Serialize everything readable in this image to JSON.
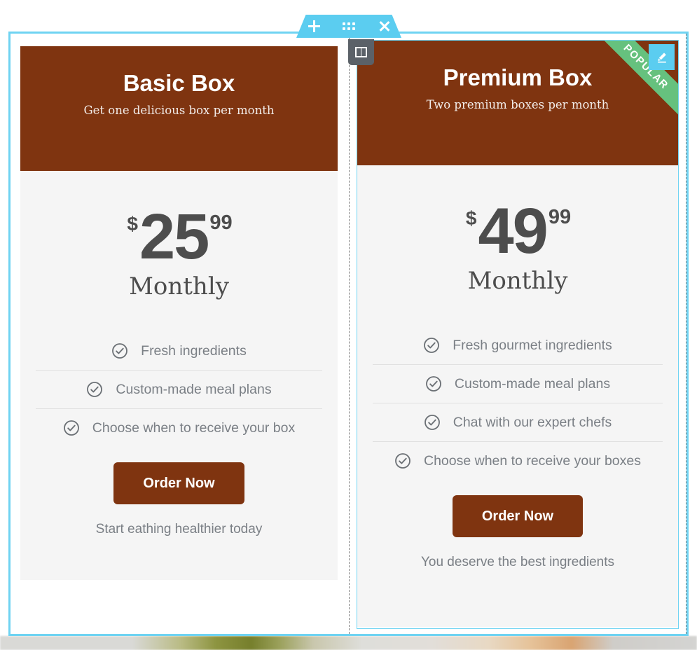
{
  "editor": {
    "section_toolbar": {
      "add_label": "+",
      "add_icon": "plus-icon",
      "drag_icon": "drag-dots-icon",
      "close_label": "×",
      "close_icon": "close-x-icon"
    },
    "column_handle": {
      "icon": "two-column-layout-icon"
    },
    "edit_button": {
      "icon": "pencil-edit-icon"
    },
    "colors": {
      "selection": "#6fd3f2",
      "toolbar": "#5bcdf0",
      "handle": "#5b6168",
      "brand_brown": "#7f3410",
      "ribbon_green": "#66c17e",
      "card_body": "#f5f5f5",
      "text_gray": "#7a7f85",
      "price_gray": "#4d4d4d"
    }
  },
  "plans": [
    {
      "id": "basic-box",
      "title": "Basic Box",
      "subtitle": "Get one delicious box per month",
      "ribbon": null,
      "price": {
        "currency": "$",
        "amount": "25",
        "cents": "99",
        "period": "Monthly"
      },
      "features": [
        "Fresh ingredients",
        "Custom-made meal plans",
        "Choose when to receive your box"
      ],
      "cta_label": "Order Now",
      "cta_note": "Start eathing healthier today"
    },
    {
      "id": "premium-box",
      "title": "Premium Box",
      "subtitle": "Two premium boxes per month",
      "ribbon": "POPULAR",
      "price": {
        "currency": "$",
        "amount": "49",
        "cents": "99",
        "period": "Monthly"
      },
      "features": [
        "Fresh gourmet ingredients",
        "Custom-made meal plans",
        "Chat with our expert chefs",
        "Choose when to receive your boxes"
      ],
      "cta_label": "Order Now",
      "cta_note": "You deserve the best ingredients"
    }
  ]
}
